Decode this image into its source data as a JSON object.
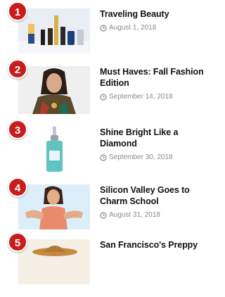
{
  "posts": [
    {
      "rank": "1",
      "title": "Traveling Beauty",
      "date": "August 1, 2018",
      "image_icon": "beauty-products-image"
    },
    {
      "rank": "2",
      "title": "Must Haves: Fall Fashion Edition",
      "date": "September 14, 2018",
      "image_icon": "fashion-model-image"
    },
    {
      "rank": "3",
      "title": "Shine Bright Like a Diamond",
      "date": "September 30, 2018",
      "image_icon": "serum-bottle-image"
    },
    {
      "rank": "4",
      "title": "Silicon Valley Goes to Charm School",
      "date": "August 31, 2018",
      "image_icon": "woman-portrait-image"
    },
    {
      "rank": "5",
      "title": "San Francisco's Preppy",
      "date": "",
      "image_icon": "hat-image"
    }
  ],
  "colors": {
    "rank_badge": "#c91c1c",
    "meta_text": "#8a8a8a",
    "title_text": "#111111"
  }
}
